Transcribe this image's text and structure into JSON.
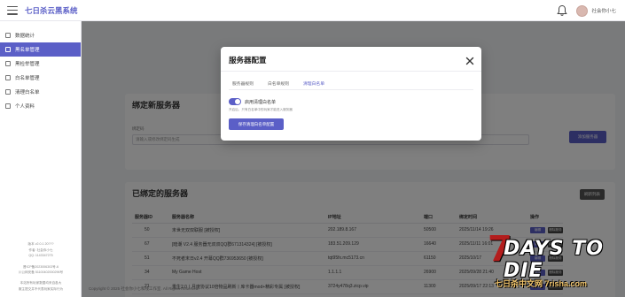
{
  "app": {
    "brand": "七日杀云黑系统"
  },
  "header": {
    "user_name": "社会你小七"
  },
  "sidebar": {
    "items": [
      {
        "label": "数据统计",
        "active": false
      },
      {
        "label": "黑名单管理",
        "active": true
      },
      {
        "label": "黑检举管理",
        "active": false
      },
      {
        "label": "白名单管理",
        "active": false
      },
      {
        "label": "清理白名单",
        "active": false
      },
      {
        "label": "个人资料",
        "active": false
      }
    ],
    "footer_lines": [
      "版本 v2.0.1 20???",
      "作者: 社会你小七",
      "QQ: 1143347275",
      "",
      "晋ICP备2023006303号-6",
      "川公网安备 51100402000296号",
      "",
      "本站所有玩家数据均来自各大",
      "服主提交并不代表玩家实际行为"
    ]
  },
  "bind_section": {
    "title": "绑定新服务器",
    "field_label": "绑定码",
    "field_placeholder": "请输入或修改绑定码生成",
    "button_label": "添加服务器"
  },
  "list_section": {
    "title": "已绑定的服务器",
    "refresh_label": "刷新列表",
    "columns": [
      "服务器ID",
      "服务器名称",
      "IP地址",
      "端口",
      "绑定时间",
      "操作"
    ],
    "rows": [
      {
        "id": "50",
        "name": "末世无双双联服 [被授权]",
        "ip": "202.189.8.167",
        "port": "50500",
        "time": "2025/11/14 19:26"
      },
      {
        "id": "67",
        "name": "[暗潮 V2.4 服务器无双双QQ群671314324] [被授权]",
        "ip": "183.51.209.129",
        "port": "16640",
        "time": "2025/11/11 16:01"
      },
      {
        "id": "51",
        "name": "不死者末日v2.4 开幕QQ群736953650 [被授权]",
        "ip": "tqt95fx.mc5173.cn",
        "port": "61150",
        "time": "2025/10/17"
      },
      {
        "id": "34",
        "name": "My Game Host",
        "ip": "1.1.1.1",
        "port": "26900",
        "time": "2025/09/28 21:40"
      },
      {
        "id": "21",
        "name": "重生2.0丨月度协议10倍物品刷新丨库卡器mod+精彩专属 [被授权]",
        "ip": "3724y478q3.zicp.vip",
        "port": "11300",
        "time": "2025/09/17 22:13"
      }
    ],
    "op_edit": "编辑",
    "op_delete": "删除服务"
  },
  "page_footer": "Copyright © 2025 社会你小七和线工作室. All Rights Reserved.",
  "modal": {
    "title": "服务器配置",
    "tabs": [
      {
        "label": "服务器规则",
        "active": false
      },
      {
        "label": "白名单规则",
        "active": false
      },
      {
        "label": "清理白名单",
        "active": true
      }
    ],
    "toggle_label": "启用清理白名单",
    "toggle_on": true,
    "toggle_desc": "开启后，只有白名单中的玩家才能进入服务器",
    "save_label": "保存清理白名单配置"
  },
  "watermark": {
    "title": "DAYS TO DIE",
    "seven": "7",
    "subtitle": "七日杀中文网 7risha.com"
  },
  "colors": {
    "accent": "#5b5fc7",
    "overlay": "rgba(0,0,0,0.5)"
  }
}
